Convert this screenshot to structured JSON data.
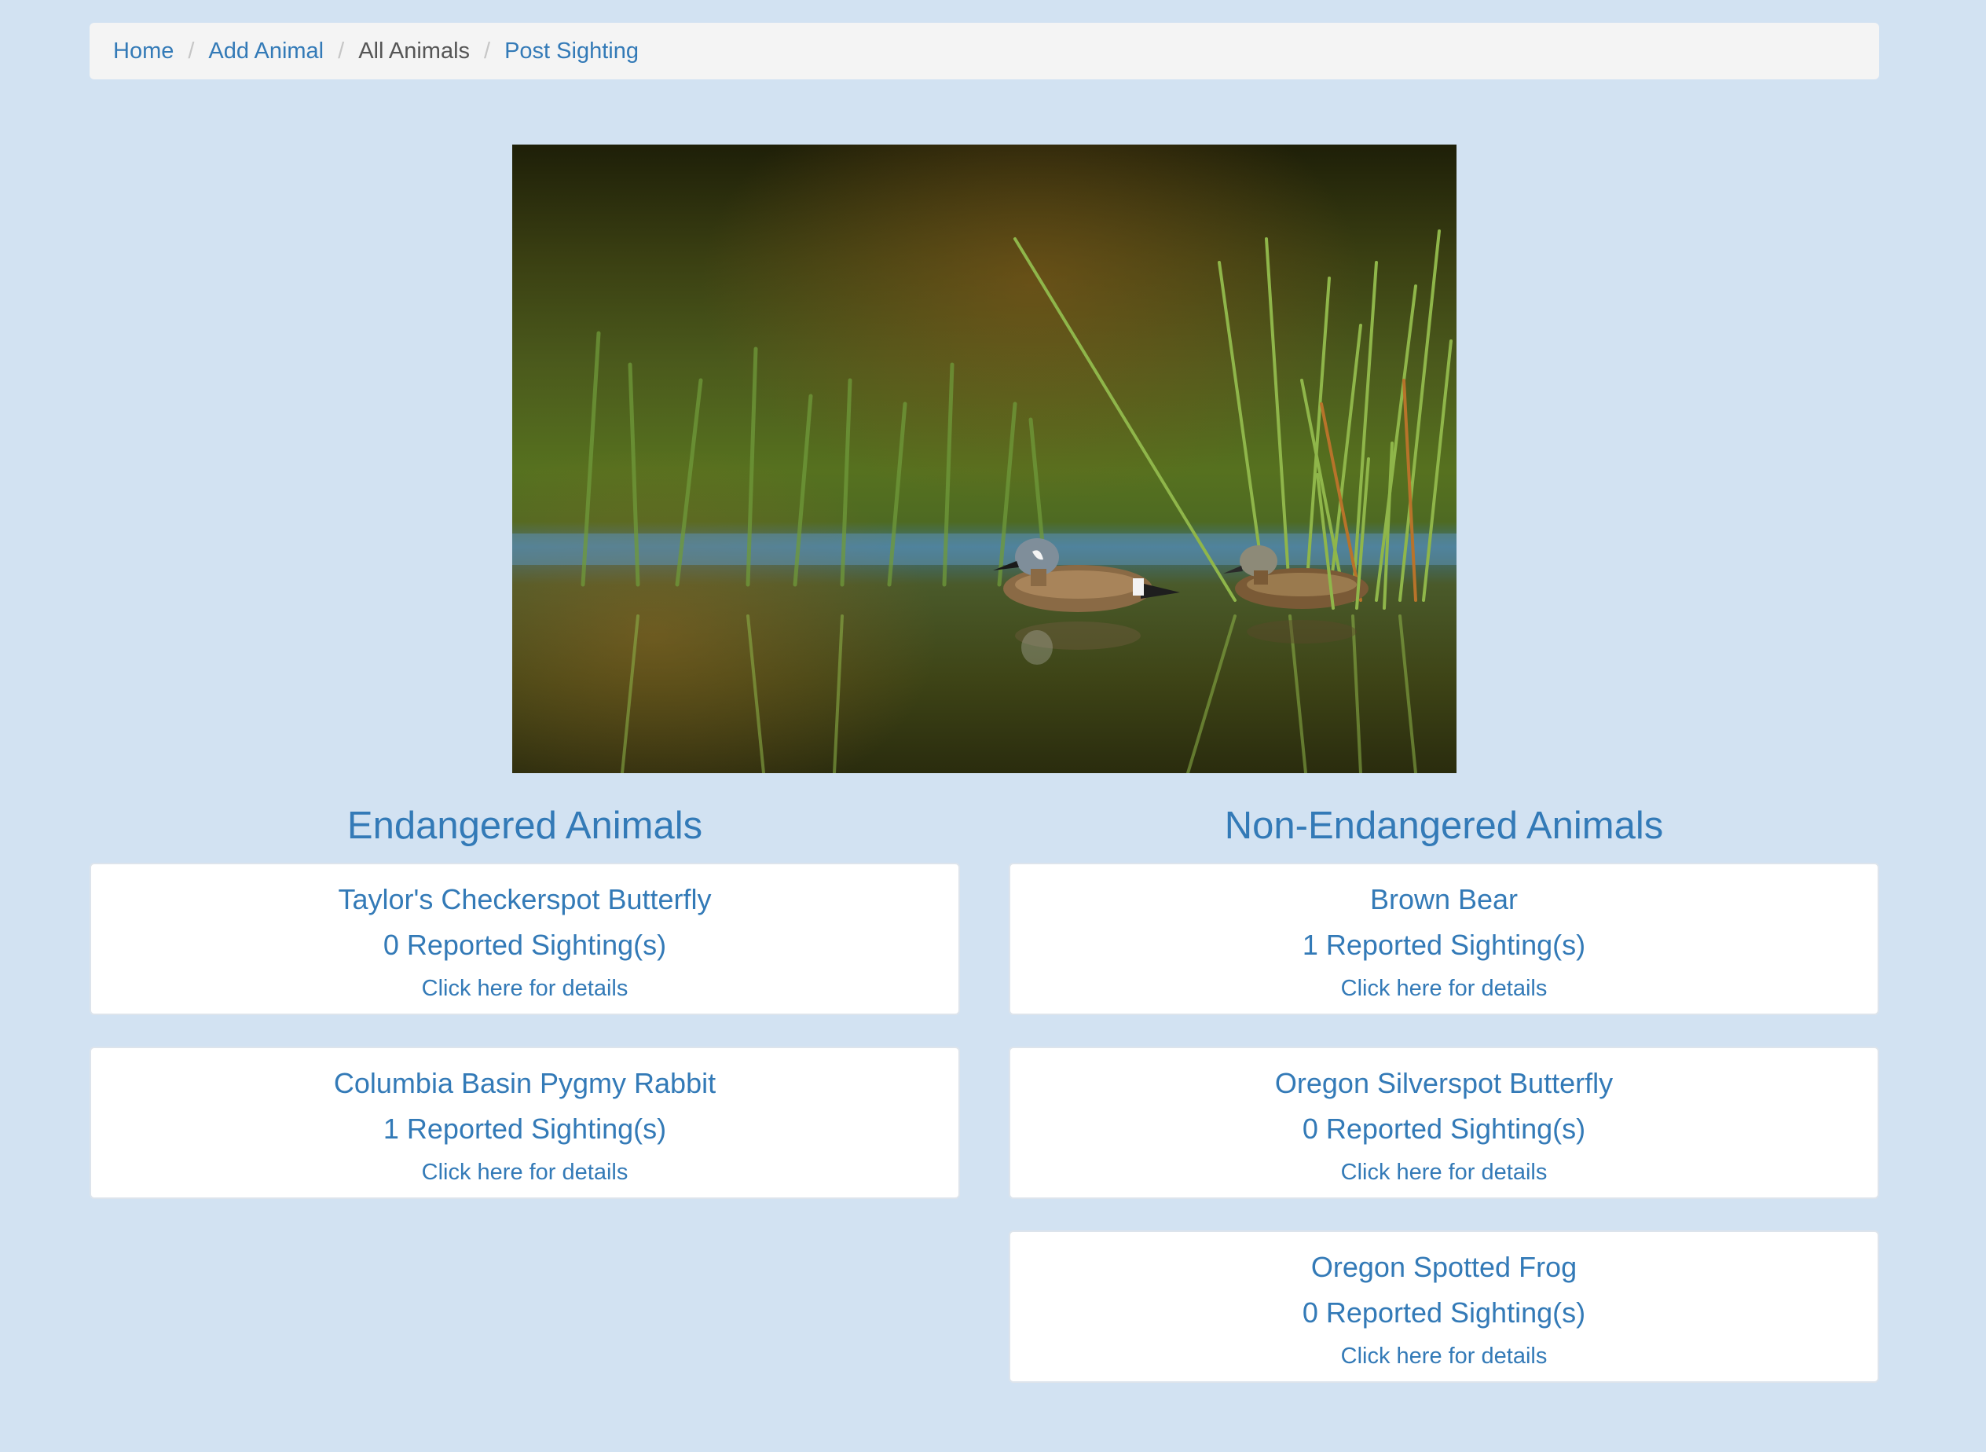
{
  "breadcrumb": {
    "home": "Home",
    "add_animal": "Add Animal",
    "all_animals": "All Animals",
    "post_sighting": "Post Sighting",
    "separator": "/"
  },
  "hero": {
    "subject": "two ducks swimming among green reeds"
  },
  "endangered": {
    "heading": "Endangered Animals",
    "animals": [
      {
        "name": "Taylor's Checkerspot Butterfly",
        "sightings": "0 Reported Sighting(s)",
        "link": "Click here for details"
      },
      {
        "name": "Columbia Basin Pygmy Rabbit",
        "sightings": "1 Reported Sighting(s)",
        "link": "Click here for details"
      }
    ]
  },
  "non_endangered": {
    "heading": "Non-Endangered Animals",
    "animals": [
      {
        "name": "Brown Bear",
        "sightings": "1 Reported Sighting(s)",
        "link": "Click here for details"
      },
      {
        "name": "Oregon Silverspot Butterfly",
        "sightings": "0 Reported Sighting(s)",
        "link": "Click here for details"
      },
      {
        "name": "Oregon Spotted Frog",
        "sightings": "0 Reported Sighting(s)",
        "link": "Click here for details"
      }
    ]
  },
  "colors": {
    "page_background": "#d2e2f2",
    "link": "#337ab7",
    "breadcrumb_background": "#f4f4f4",
    "active_crumb": "#555555"
  }
}
